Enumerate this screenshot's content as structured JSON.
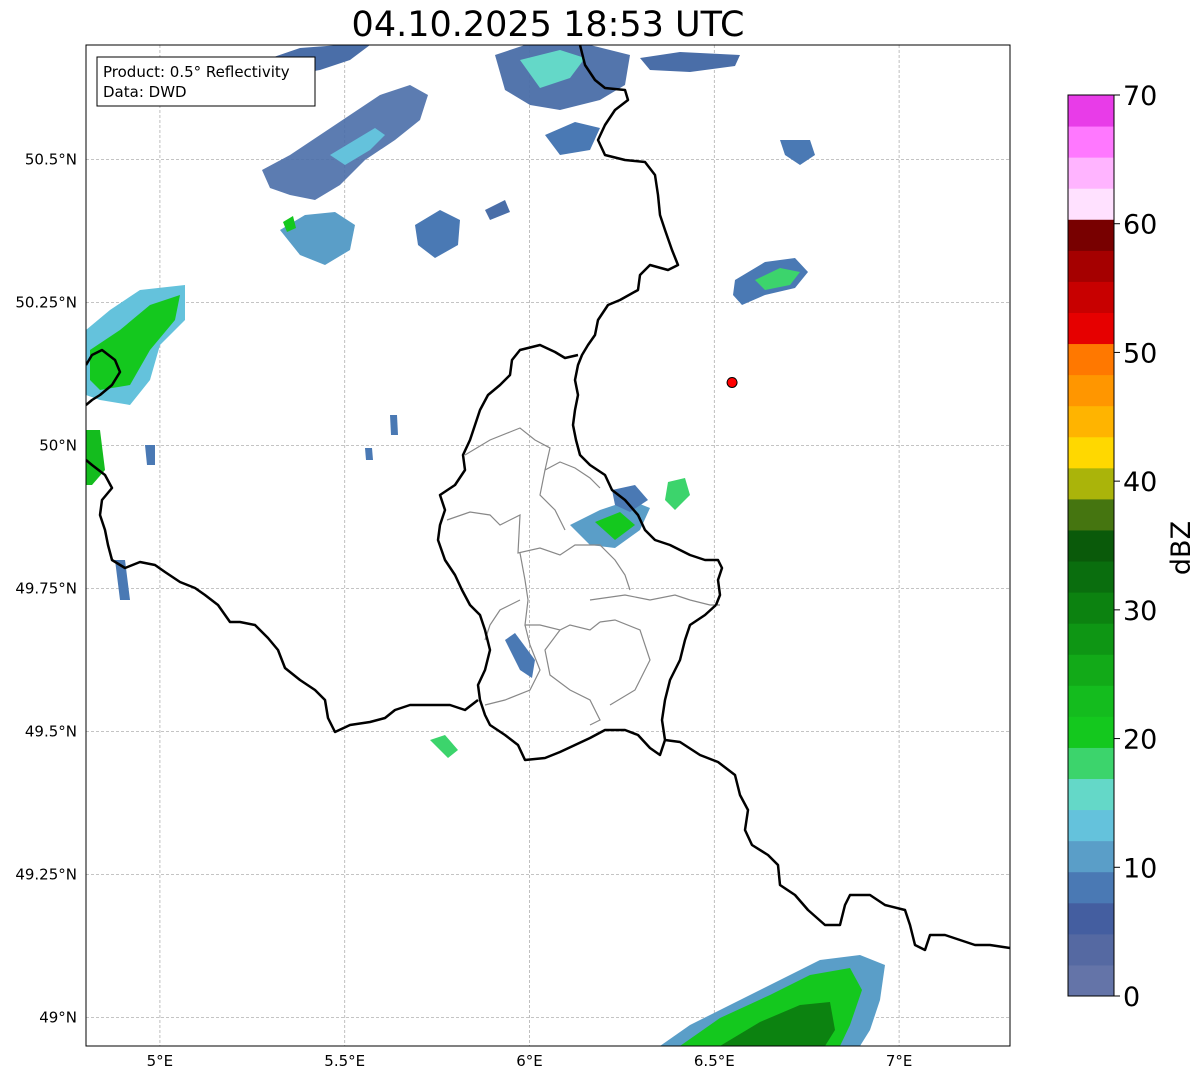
{
  "title": "04.10.2025 18:53 UTC",
  "info_box": {
    "line1": "Product: 0.5° Reflectivity",
    "line2": "Data: DWD"
  },
  "map": {
    "lon_range": [
      4.8,
      7.3
    ],
    "lat_range": [
      48.95,
      50.7
    ],
    "lon_ticks": [
      {
        "value": 5.0,
        "label": "5°E"
      },
      {
        "value": 5.5,
        "label": "5.5°E"
      },
      {
        "value": 6.0,
        "label": "6°E"
      },
      {
        "value": 6.5,
        "label": "6.5°E"
      },
      {
        "value": 7.0,
        "label": "7°E"
      }
    ],
    "lat_ticks": [
      {
        "value": 50.5,
        "label": "50.5°N"
      },
      {
        "value": 50.25,
        "label": "50.25°N"
      },
      {
        "value": 50.0,
        "label": "50°N"
      },
      {
        "value": 49.75,
        "label": "49.75°N"
      },
      {
        "value": 49.5,
        "label": "49.5°N"
      },
      {
        "value": 49.25,
        "label": "49.25°N"
      },
      {
        "value": 49.0,
        "label": "49°N"
      }
    ],
    "grid": true,
    "radar_site": {
      "lon": 6.548,
      "lat": 50.11,
      "color": "#ff0000"
    }
  },
  "colorbar": {
    "label": "dBZ",
    "min": 0,
    "max": 70,
    "tick_labels": [
      "0",
      "10",
      "20",
      "30",
      "40",
      "50",
      "60",
      "70"
    ],
    "colors": [
      "#6474a8",
      "#5569a2",
      "#445ea0",
      "#4a79b4",
      "#5a9ec8",
      "#64c2dc",
      "#64d8c8",
      "#3cd46c",
      "#14c81e",
      "#14bc1e",
      "#12aa18",
      "#0e9614",
      "#0c8210",
      "#0a6e0e",
      "#0a5a0a",
      "#457510",
      "#aab40a",
      "#ffd800",
      "#ffb400",
      "#ff9600",
      "#ff7800",
      "#e60000",
      "#c80000",
      "#a50000",
      "#780000",
      "#ffe1ff",
      "#ffb4ff",
      "#ff78ff",
      "#e83ce8"
    ]
  }
}
